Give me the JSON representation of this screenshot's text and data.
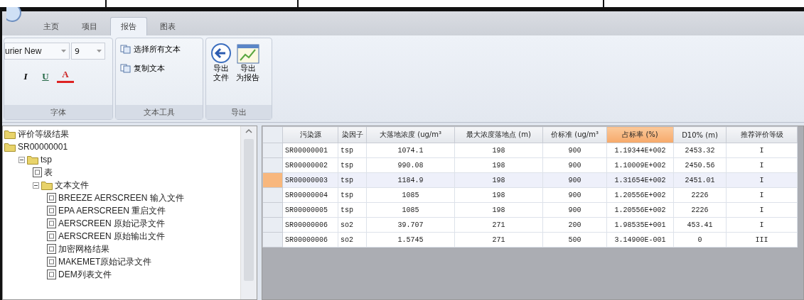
{
  "ribbon": {
    "tabs": [
      {
        "label": "主页",
        "selected": false
      },
      {
        "label": "项目",
        "selected": false
      },
      {
        "label": "报告",
        "selected": true
      },
      {
        "label": "图表",
        "selected": false
      }
    ],
    "groups": [
      {
        "kind": "font",
        "title": "字体",
        "font": "urier New",
        "size": "9",
        "buttons": [
          "I",
          "U",
          "A"
        ]
      },
      {
        "kind": "list",
        "title": "文本工具",
        "items": [
          "选择所有文本",
          "复制文本"
        ]
      },
      {
        "kind": "large",
        "title": "导出",
        "items": [
          [
            "导出",
            "文件"
          ],
          [
            "导出",
            "为报告"
          ]
        ]
      }
    ]
  },
  "tree": [
    {
      "label": "评价等级结果",
      "kind": "folder"
    },
    {
      "label": "SR00000001",
      "kind": "folder",
      "children": [
        {
          "label": "tsp",
          "kind": "folder",
          "expanded": true,
          "children": [
            {
              "label": "表",
              "kind": "file"
            },
            {
              "label": "文本文件",
              "kind": "folder",
              "expanded": true,
              "children": [
                {
                  "label": "BREEZE AERSCREEN 输入文件",
                  "kind": "file"
                },
                {
                  "label": "EPA AERSCREEN 重启文件",
                  "kind": "file"
                },
                {
                  "label": "AERSCREEN 原始记录文件",
                  "kind": "file"
                },
                {
                  "label": "AERSCREEN 原始输出文件",
                  "kind": "file"
                },
                {
                  "label": "加密网格结果",
                  "kind": "file"
                },
                {
                  "label": "MAKEMET原始记录文件",
                  "kind": "file"
                },
                {
                  "label": "DEM列表文件",
                  "kind": "file"
                }
              ]
            }
          ]
        }
      ]
    }
  ],
  "table": {
    "columns": [
      {
        "label": "污染源",
        "selected": false
      },
      {
        "label": "染因子",
        "selected": false
      },
      {
        "label": "大落地浓度 (ug/m³",
        "selected": false
      },
      {
        "label": "最大浓度落地点 (m)",
        "selected": false
      },
      {
        "label": "价标准 (ug/m³",
        "selected": false
      },
      {
        "label": "占标率 (%)",
        "selected": true
      },
      {
        "label": "D10% (m)",
        "selected": false
      },
      {
        "label": "推荐评价等级",
        "selected": false
      }
    ],
    "rows": [
      {
        "selected": false,
        "cells": [
          "SR00000001",
          "tsp",
          "1074.1",
          "198",
          "900",
          "1.19344E+002",
          "2453.32",
          "I"
        ]
      },
      {
        "selected": false,
        "cells": [
          "SR00000002",
          "tsp",
          "990.08",
          "198",
          "900",
          "1.10009E+002",
          "2450.56",
          "I"
        ]
      },
      {
        "selected": true,
        "cells": [
          "SR00000003",
          "tsp",
          "1184.9",
          "198",
          "900",
          "1.31654E+002",
          "2451.01",
          "I"
        ]
      },
      {
        "selected": false,
        "cells": [
          "SR00000004",
          "tsp",
          "1085",
          "198",
          "900",
          "1.20556E+002",
          "2226",
          "I"
        ]
      },
      {
        "selected": false,
        "cells": [
          "SR00000005",
          "tsp",
          "1085",
          "198",
          "900",
          "1.20556E+002",
          "2226",
          "I"
        ]
      },
      {
        "selected": false,
        "cells": [
          "SR00000006",
          "so2",
          "39.707",
          "271",
          "200",
          "1.98535E+001",
          "453.41",
          "I"
        ]
      },
      {
        "selected": false,
        "cells": [
          "SR00000006",
          "so2",
          "1.5745",
          "271",
          "500",
          "3.14900E-001",
          "0",
          "III"
        ]
      }
    ]
  }
}
